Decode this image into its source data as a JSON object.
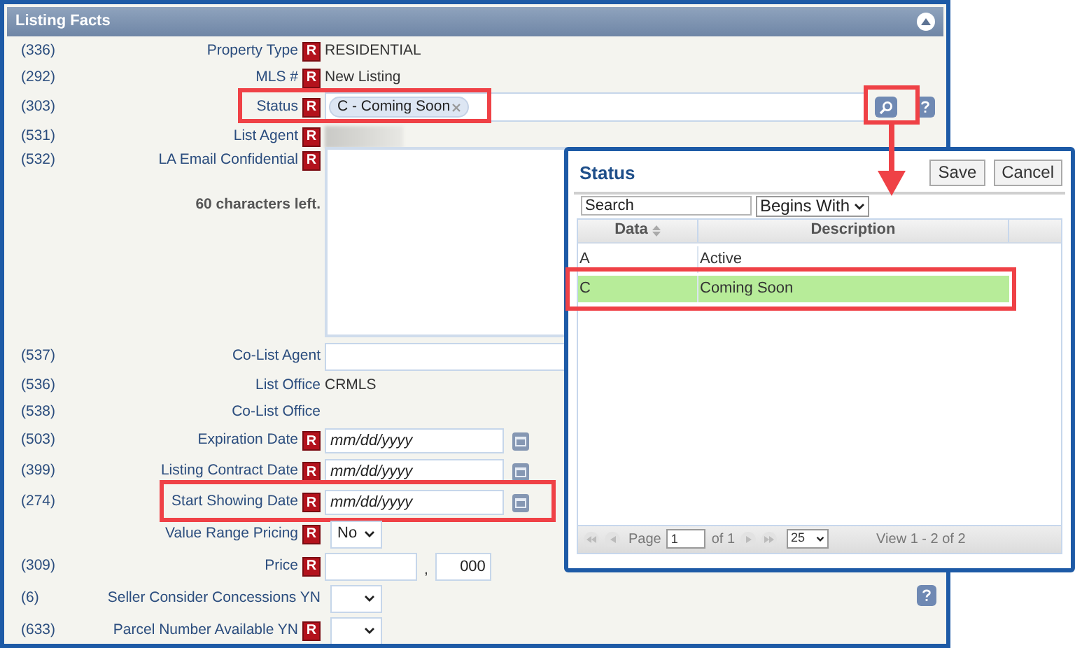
{
  "panel": {
    "title": "Listing Facts",
    "expanded": true,
    "fields": [
      {
        "kind": "text",
        "code": "(336)",
        "label": "Property Type",
        "badge": "R",
        "value": "RESIDENTIAL"
      },
      {
        "kind": "text",
        "code": "(292)",
        "label": "MLS #",
        "badge": "R",
        "value": "New Listing"
      },
      {
        "kind": "chip",
        "code": "(303)",
        "label": "Status",
        "badge": "R",
        "value": "C - Coming Soon",
        "highlighted": true,
        "help": true,
        "lookup": {
          "highlighted": true
        }
      },
      {
        "kind": "redacted",
        "code": "(531)",
        "label": "List Agent",
        "badge": "R"
      },
      {
        "kind": "textarea",
        "code": "(532)",
        "label": "LA Email Confidential",
        "badge": "R",
        "note": "60 characters left."
      },
      {
        "kind": "input",
        "code": "(537)",
        "label": "Co-List Agent"
      },
      {
        "kind": "text",
        "code": "(536)",
        "label": "List Office",
        "value": "CRMLS"
      },
      {
        "kind": "text",
        "code": "(538)",
        "label": "Co-List Office"
      },
      {
        "kind": "date",
        "code": "(503)",
        "label": "Expiration Date",
        "badge": "R",
        "placeholder": "mm/dd/yyyy"
      },
      {
        "kind": "date",
        "code": "(399)",
        "label": "Listing Contract Date",
        "badge": "R",
        "placeholder": "mm/dd/yyyy"
      },
      {
        "kind": "date",
        "code": "(274)",
        "label": "Start Showing Date",
        "badge": "R",
        "placeholder": "mm/dd/yyyy",
        "highlighted": true
      },
      {
        "kind": "select",
        "label": "Value Range Pricing",
        "badge": "R",
        "value": "No"
      },
      {
        "kind": "price",
        "code": "(309)",
        "label": "Price",
        "badge": "R",
        "separator": ",",
        "cents": "000"
      },
      {
        "kind": "select",
        "code": "(6)",
        "label": "Seller Consider Concessions YN",
        "help": true
      },
      {
        "kind": "select",
        "code": "(633)",
        "label": "Parcel Number Available YN",
        "badge": "R"
      }
    ]
  },
  "popup": {
    "title": "Status",
    "buttons": [
      "Save",
      "Cancel"
    ],
    "search": {
      "placeholder": "Search"
    },
    "match_mode": "Begins With",
    "columns": [
      {
        "label": "Data",
        "sortable": true
      },
      {
        "label": "Description",
        "sortable": false
      }
    ],
    "rows": [
      {
        "data": "A",
        "description": "Active",
        "selected": false,
        "highlighted": false
      },
      {
        "data": "C",
        "description": "Coming Soon",
        "selected": true,
        "highlighted": true
      }
    ],
    "pager": {
      "page_label": "Page",
      "page": "1",
      "of": "of 1",
      "page_size": "25",
      "summary": "View 1 - 2 of 2"
    }
  }
}
